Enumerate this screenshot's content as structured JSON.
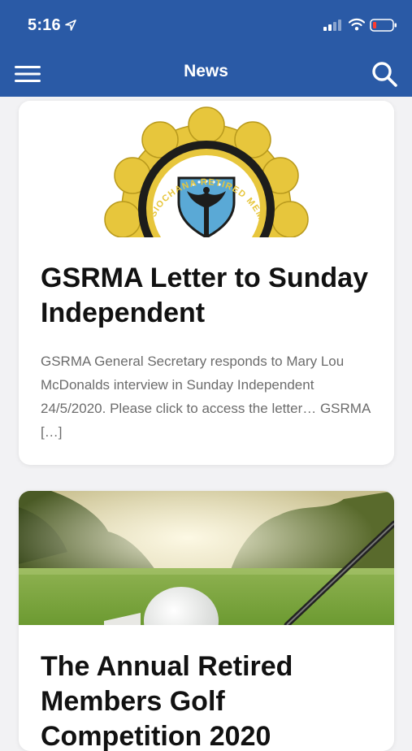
{
  "status_bar": {
    "time": "5:16"
  },
  "nav": {
    "title": "News"
  },
  "posts": [
    {
      "title": "GSRMA Letter to Sunday Independent",
      "excerpt": "GSRMA General Secretary responds to Mary Lou McDonalds interview in Sunday Independent 24/5/2020. Please click to access the letter… GSRMA […]",
      "image_emblem_text": "SIOCHANA RETIRED MEMBERS ASSOC"
    },
    {
      "title": "The Annual Retired Members Golf Competition 2020"
    }
  ],
  "colors": {
    "header_bg": "#2a5aa6",
    "page_bg": "#f2f2f4",
    "emblem_gold": "#e7c63c",
    "emblem_shield": "#5aa9d6"
  },
  "icons": [
    "location-arrow-icon",
    "signal-icon",
    "wifi-icon",
    "battery-icon",
    "menu-icon",
    "search-icon"
  ]
}
